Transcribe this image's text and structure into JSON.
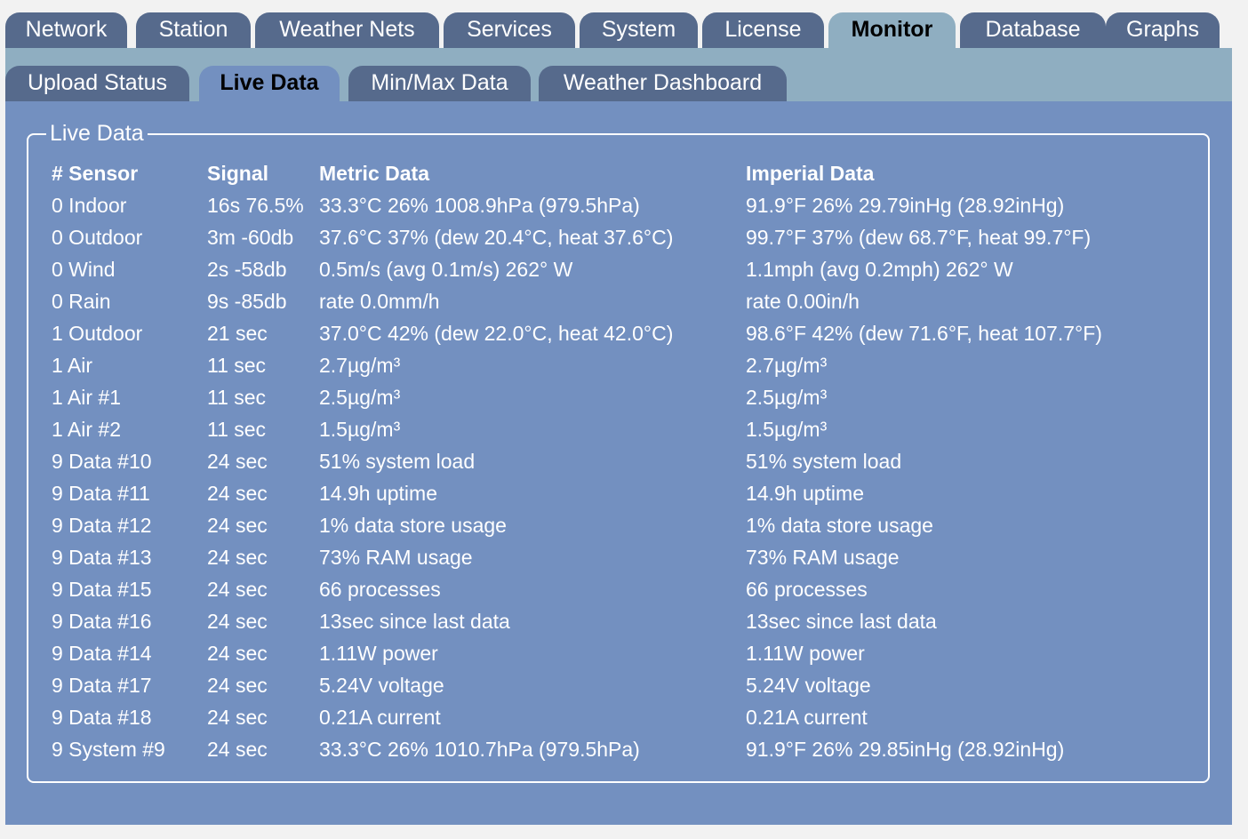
{
  "top_tabs": [
    {
      "label": "Network",
      "active": false
    },
    {
      "label": "Station",
      "active": false
    },
    {
      "label": "Weather Nets",
      "active": false
    },
    {
      "label": "Services",
      "active": false
    },
    {
      "label": "System",
      "active": false
    },
    {
      "label": "License",
      "active": false
    },
    {
      "label": "Monitor",
      "active": true
    },
    {
      "label": "Database",
      "active": false
    },
    {
      "label": "Graphs",
      "active": false
    }
  ],
  "sub_tabs": [
    {
      "label": "Upload Status",
      "active": false
    },
    {
      "label": "Live Data",
      "active": true
    },
    {
      "label": "Min/Max Data",
      "active": false
    },
    {
      "label": "Weather Dashboard",
      "active": false
    }
  ],
  "panel": {
    "legend": "Live Data",
    "headers": {
      "sensor": "# Sensor",
      "signal": "Signal",
      "metric": "Metric Data",
      "imperial": "Imperial Data"
    },
    "rows": [
      {
        "sensor": "0 Indoor",
        "signal": "16s 76.5%",
        "metric": "33.3°C 26% 1008.9hPa (979.5hPa)",
        "imperial": "91.9°F 26% 29.79inHg (28.92inHg)"
      },
      {
        "sensor": "0 Outdoor",
        "signal": "3m -60db",
        "metric": "37.6°C 37% (dew 20.4°C, heat 37.6°C)",
        "imperial": "99.7°F 37% (dew 68.7°F, heat 99.7°F)"
      },
      {
        "sensor": "0 Wind",
        "signal": "2s -58db",
        "metric": "0.5m/s (avg 0.1m/s) 262° W",
        "imperial": "1.1mph (avg 0.2mph) 262° W"
      },
      {
        "sensor": "0 Rain",
        "signal": "9s -85db",
        "metric": "rate 0.0mm/h",
        "imperial": "rate 0.00in/h"
      },
      {
        "sensor": "1 Outdoor",
        "signal": "21 sec",
        "metric": "37.0°C 42% (dew 22.0°C, heat 42.0°C)",
        "imperial": "98.6°F 42% (dew 71.6°F, heat 107.7°F)"
      },
      {
        "sensor": "1 Air",
        "signal": "11 sec",
        "metric": "2.7µg/m³",
        "imperial": "2.7µg/m³"
      },
      {
        "sensor": "1 Air #1",
        "signal": "11 sec",
        "metric": "2.5µg/m³",
        "imperial": "2.5µg/m³"
      },
      {
        "sensor": "1 Air #2",
        "signal": "11 sec",
        "metric": "1.5µg/m³",
        "imperial": "1.5µg/m³"
      },
      {
        "sensor": "9 Data #10",
        "signal": "24 sec",
        "metric": "51% system load",
        "imperial": "51% system load"
      },
      {
        "sensor": "9 Data #11",
        "signal": "24 sec",
        "metric": "14.9h uptime",
        "imperial": "14.9h uptime"
      },
      {
        "sensor": "9 Data #12",
        "signal": "24 sec",
        "metric": "1% data store usage",
        "imperial": "1% data store usage"
      },
      {
        "sensor": "9 Data #13",
        "signal": "24 sec",
        "metric": "73% RAM usage",
        "imperial": "73% RAM usage"
      },
      {
        "sensor": "9 Data #15",
        "signal": "24 sec",
        "metric": "66 processes",
        "imperial": "66 processes"
      },
      {
        "sensor": "9 Data #16",
        "signal": "24 sec",
        "metric": "13sec since last data",
        "imperial": "13sec since last data"
      },
      {
        "sensor": "9 Data #14",
        "signal": "24 sec",
        "metric": "1.11W power",
        "imperial": "1.11W power"
      },
      {
        "sensor": "9 Data #17",
        "signal": "24 sec",
        "metric": "5.24V voltage",
        "imperial": "5.24V voltage"
      },
      {
        "sensor": "9 Data #18",
        "signal": "24 sec",
        "metric": "0.21A current",
        "imperial": "0.21A current"
      },
      {
        "sensor": "9 System #9",
        "signal": "24 sec",
        "metric": "33.3°C 26% 1010.7hPa (979.5hPa)",
        "imperial": "91.9°F 26% 29.85inHg (28.92inHg)"
      }
    ]
  },
  "colors": {
    "tab_inactive": "#566a8c",
    "tab_bar_active": "#8faec1",
    "content_background": "#7390c0",
    "text": "#ffffff"
  }
}
